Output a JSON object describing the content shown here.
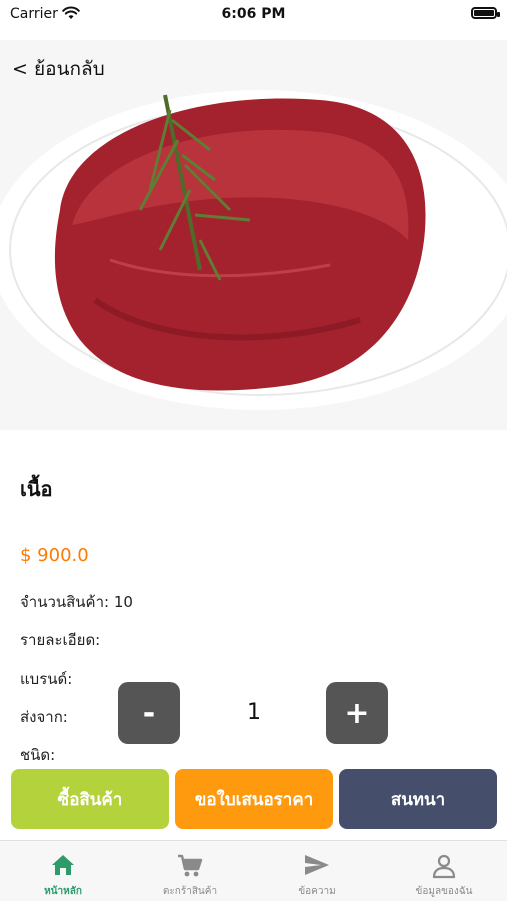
{
  "status_bar": {
    "carrier": "Carrier",
    "time": "6:06 PM"
  },
  "nav": {
    "back_label": "< ย้อนกลับ"
  },
  "product": {
    "name": "เนื้อ",
    "price": "$ 900.0",
    "stock": "จำนวนสินค้า: 10",
    "detail": "รายละเอียด:",
    "brand": "แบรนด์:",
    "ship_from": "ส่งจาก:",
    "type": "ชนิด:"
  },
  "quantity": {
    "minus": "-",
    "value": "1",
    "plus": "+"
  },
  "actions": {
    "buy": "ซื้อสินค้า",
    "quote": "ขอใบเสนอราคา",
    "chat": "สนทนา"
  },
  "colors": {
    "buy": "#b4d23c",
    "quote": "#ff9a0e",
    "chat": "#454e6a",
    "price": "#ff7a00",
    "tab_active": "#2f9b6b"
  },
  "tabbar": {
    "items": [
      {
        "label": "หน้าหลัก",
        "icon": "home-icon",
        "active": true
      },
      {
        "label": "ตะกร้าสินค้า",
        "icon": "cart-icon",
        "active": false
      },
      {
        "label": "ข้อความ",
        "icon": "send-icon",
        "active": false
      },
      {
        "label": "ข้อมูลของฉัน",
        "icon": "person-icon",
        "active": false
      }
    ]
  }
}
